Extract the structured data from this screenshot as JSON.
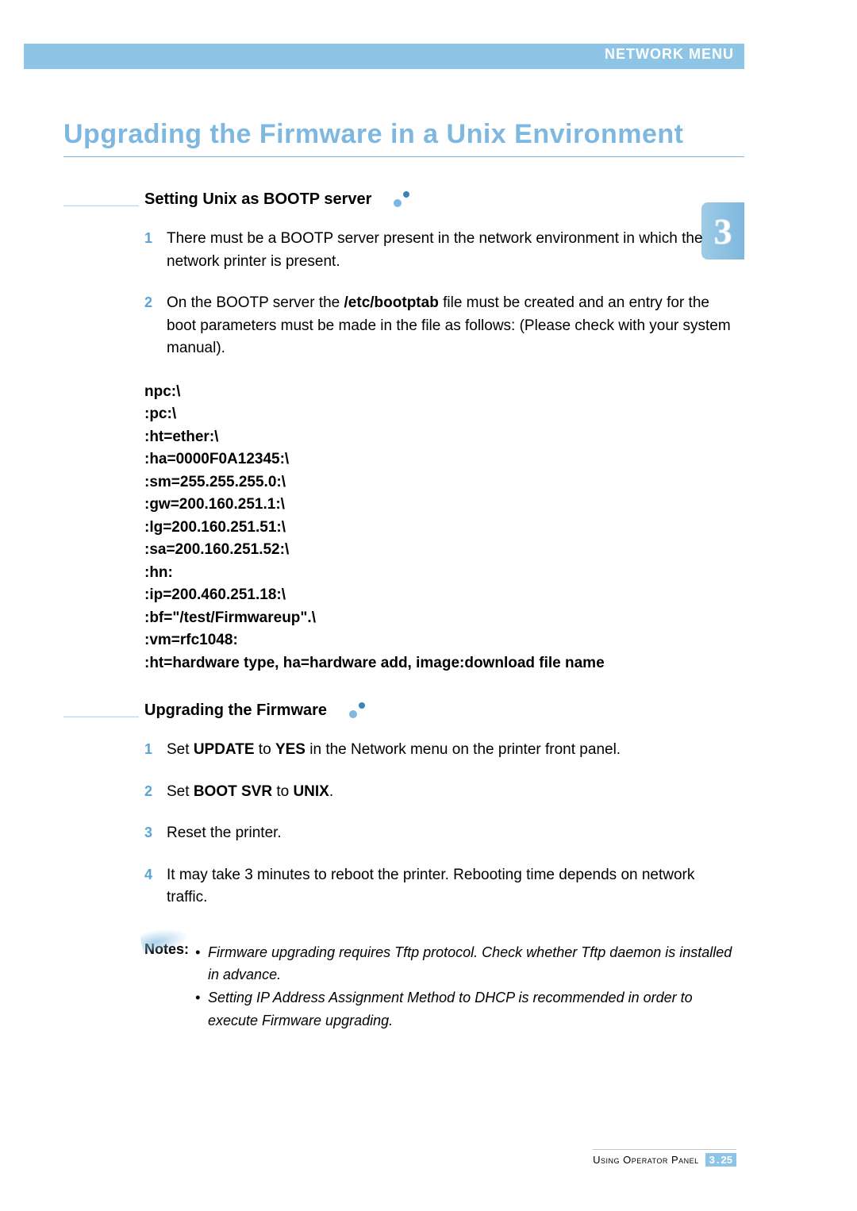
{
  "header": {
    "section": "NETWORK MENU"
  },
  "title": "Upgrading the Firmware in a Unix Environment",
  "side_tab": "3",
  "section1": {
    "heading": "Setting Unix as BOOTP server",
    "steps": {
      "s1_num": "1",
      "s1_text": "There must be a BOOTP server present in the network environment in which the network printer is present.",
      "s2_num": "2",
      "s2_text_pre": "On the BOOTP server the ",
      "s2_bold": "/etc/bootptab",
      "s2_text_post": " file must be created and an entry for the boot parameters must be made in the file as follows: (Please check with your system manual)."
    }
  },
  "code": "npc:\\\n:pc:\\\n:ht=ether:\\\n:ha=0000F0A12345:\\\n:sm=255.255.255.0:\\\n:gw=200.160.251.1:\\\n:lg=200.160.251.51:\\\n:sa=200.160.251.52:\\\n:hn:\n:ip=200.460.251.18:\\\n:bf=\"/test/Firmwareup\".\\\n:vm=rfc1048:\n:ht=hardware type, ha=hardware add, image:download file name",
  "section2": {
    "heading": "Upgrading the Firmware",
    "steps": {
      "s1_num": "1",
      "s1_pre": "Set ",
      "s1_b1": "UPDATE",
      "s1_mid": " to ",
      "s1_b2": "YES",
      "s1_post": " in the Network menu on the printer front panel.",
      "s2_num": "2",
      "s2_pre": "Set ",
      "s2_b1": "BOOT SVR",
      "s2_mid": " to ",
      "s2_b2": "UNIX",
      "s2_post": ".",
      "s3_num": "3",
      "s3_text": "Reset the printer.",
      "s4_num": "4",
      "s4_text": "It may take 3 minutes to reboot the printer. Rebooting time depends on network traffic."
    }
  },
  "notes": {
    "label": "Notes:",
    "n1": "Firmware upgrading requires Tftp protocol. Check whether Tftp daemon is installed in advance.",
    "n2": "Setting IP Address Assignment Method to DHCP is recommended in order to execute Firmware upgrading."
  },
  "footer": {
    "label": "Using Operator Panel",
    "chapter": "3",
    "page": "25"
  }
}
